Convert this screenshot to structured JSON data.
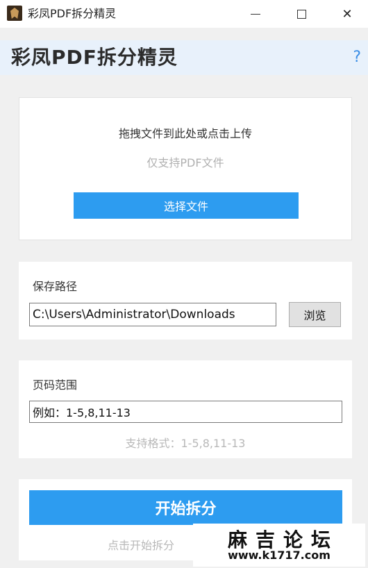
{
  "window": {
    "title": "彩凤PDF拆分精灵",
    "icon": "app-logo-icon",
    "controls": {
      "minimize": "minimize-icon",
      "maximize": "maximize-icon",
      "close": "✕"
    }
  },
  "header": {
    "app_name": "彩凤PDF拆分精灵",
    "help": "?"
  },
  "upload": {
    "title": "拖拽文件到此处或点击上传",
    "hint": "仅支持PDF文件",
    "button_label": "选择文件"
  },
  "save": {
    "label": "保存路径",
    "path_value": "C:\\Users\\Administrator\\Downloads",
    "browse_label": "浏览"
  },
  "page_range": {
    "label": "页码范围",
    "placeholder": "例如：1-5,8,11-13",
    "hint": "支持格式：1-5,8,11-13"
  },
  "action": {
    "start_label": "开始拆分",
    "hint": "点击开始拆分"
  },
  "watermark": {
    "title": "麻吉论坛",
    "url": "www.k1717.com"
  },
  "colors": {
    "accent": "#2d9cf0",
    "header_bg": "#e8f1fb",
    "help": "#3a8ee6",
    "window_bg": "#f0f0f0"
  }
}
